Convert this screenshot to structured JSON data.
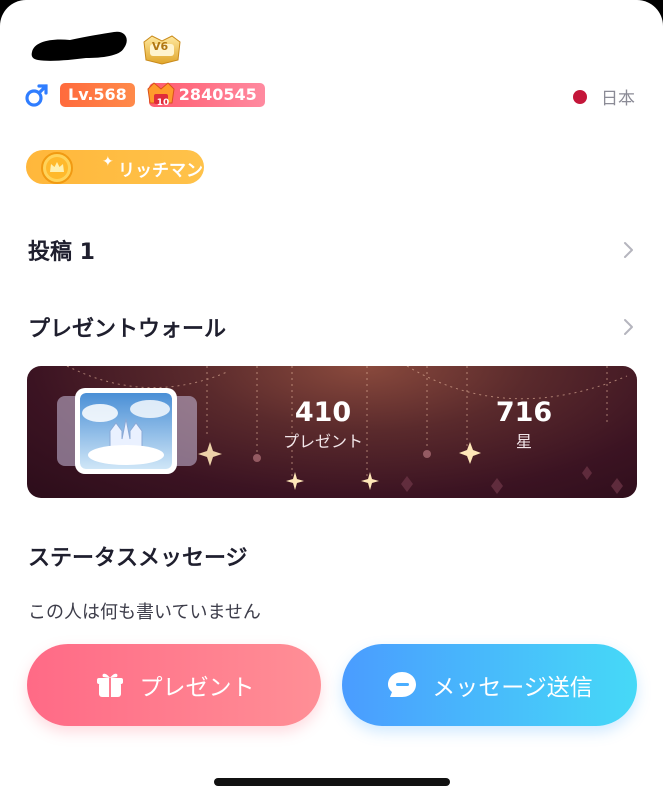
{
  "header": {
    "vip_label": "V6",
    "level_label": "Lv.568",
    "wealth_value": "2840545",
    "wealth_rank": "10",
    "country": "日本",
    "title_badge": "リッチマン"
  },
  "posts": {
    "label": "投稿 1"
  },
  "gift_wall": {
    "title": "プレゼントウォール",
    "stats": [
      {
        "value": "410",
        "label": "プレゼント"
      },
      {
        "value": "716",
        "label": "星"
      }
    ]
  },
  "status": {
    "title": "ステータスメッセージ",
    "text": "この人は何も書いていません"
  },
  "actions": {
    "gift_label": "プレゼント",
    "message_label": "メッセージ送信"
  },
  "colors": {
    "level": "#ff6a3d",
    "wealth": "#ff5b6e",
    "title_badge": "#ffb73b",
    "gift_button": "#ff6a86",
    "message_button": "#4a9cff",
    "gender": "#2f7dff"
  },
  "icons": {
    "gender": "male-icon",
    "vip": "vip-crown-badge-icon",
    "wealth": "crown-icon",
    "title": "coin-crown-icon",
    "chevron": "chevron-right-icon",
    "gift": "gift-icon",
    "message": "chat-bubble-icon"
  }
}
